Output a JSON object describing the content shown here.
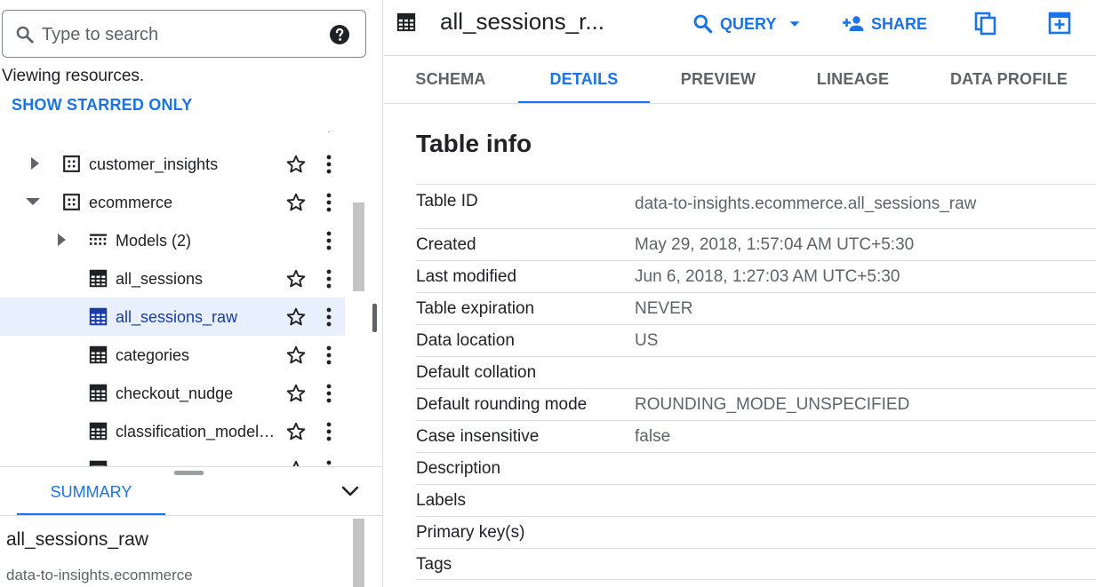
{
  "search": {
    "placeholder": "Type to search"
  },
  "explorer": {
    "viewing_text": "Viewing resources.",
    "show_starred_label": "SHOW STARRED ONLY",
    "tree": [
      {
        "label": "customer_insights",
        "type": "dataset",
        "expander": "collapsed",
        "starred": false,
        "selected": false
      },
      {
        "label": "ecommerce",
        "type": "dataset",
        "expander": "expanded",
        "starred": false,
        "selected": false
      },
      {
        "label": "Models (2)",
        "type": "models",
        "expander": "collapsed",
        "starred": null,
        "selected": false
      },
      {
        "label": "all_sessions",
        "type": "table",
        "expander": null,
        "starred": false,
        "selected": false
      },
      {
        "label": "all_sessions_raw",
        "type": "table",
        "expander": null,
        "starred": false,
        "selected": true
      },
      {
        "label": "categories",
        "type": "table",
        "expander": null,
        "starred": false,
        "selected": false
      },
      {
        "label": "checkout_nudge",
        "type": "table",
        "expander": null,
        "starred": false,
        "selected": false
      },
      {
        "label": "classification_model_2",
        "type": "table",
        "expander": null,
        "starred": false,
        "selected": false
      }
    ]
  },
  "summary": {
    "tab_label": "SUMMARY",
    "name": "all_sessions_raw",
    "path": "data-to-insights.ecommerce"
  },
  "header": {
    "title": "all_sessions_r...",
    "query_label": "QUERY",
    "share_label": "SHARE"
  },
  "tabs": [
    {
      "id": "schema",
      "label": "SCHEMA",
      "active": false
    },
    {
      "id": "details",
      "label": "DETAILS",
      "active": true
    },
    {
      "id": "preview",
      "label": "PREVIEW",
      "active": false
    },
    {
      "id": "lineage",
      "label": "LINEAGE",
      "active": false
    },
    {
      "id": "data-profile",
      "label": "DATA PROFILE",
      "active": false
    }
  ],
  "table_info": {
    "title": "Table info",
    "rows": [
      {
        "key": "Table ID",
        "value": "data-to-insights.ecommerce.all_sessions_raw"
      },
      {
        "key": "Created",
        "value": "May 29, 2018, 1:57:04 AM UTC+5:30"
      },
      {
        "key": "Last modified",
        "value": "Jun 6, 2018, 1:27:03 AM UTC+5:30"
      },
      {
        "key": "Table expiration",
        "value": "NEVER"
      },
      {
        "key": "Data location",
        "value": "US"
      },
      {
        "key": "Default collation",
        "value": ""
      },
      {
        "key": "Default rounding mode",
        "value": "ROUNDING_MODE_UNSPECIFIED"
      },
      {
        "key": "Case insensitive",
        "value": "false"
      },
      {
        "key": "Description",
        "value": ""
      },
      {
        "key": "Labels",
        "value": ""
      },
      {
        "key": "Primary key(s)",
        "value": ""
      },
      {
        "key": "Tags",
        "value": ""
      }
    ]
  },
  "colors": {
    "accent": "#1a73e8",
    "selected_bg": "#e8f0fe",
    "text_primary": "#202124",
    "text_secondary": "#5f6368",
    "divider": "#dadce0"
  }
}
